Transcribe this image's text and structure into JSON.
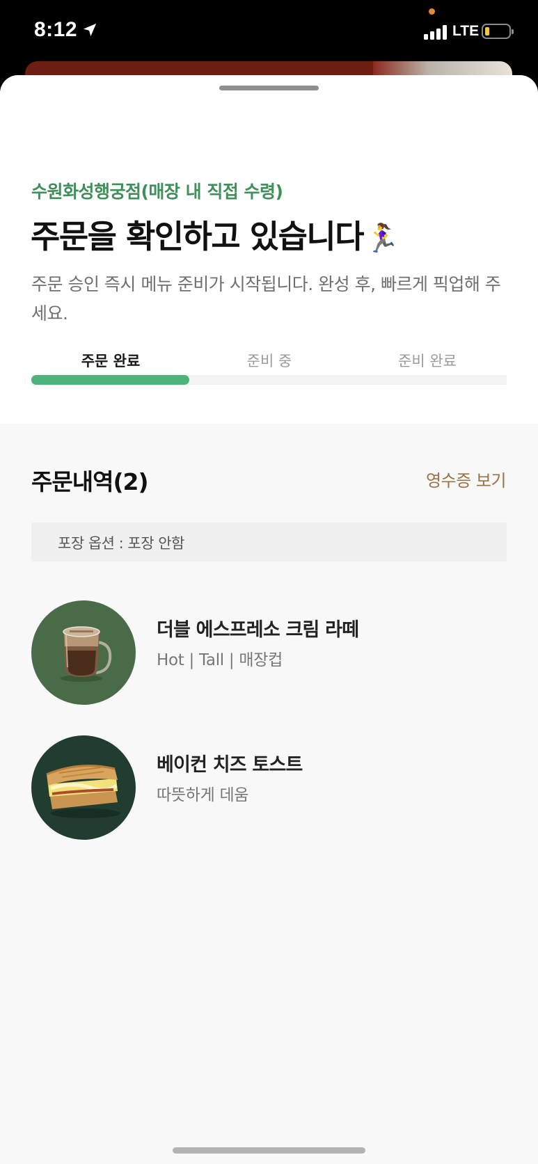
{
  "status_bar": {
    "time": "8:12",
    "network": "LTE",
    "battery_level": 0.18,
    "colors": {
      "battery_fill": "#f6c838",
      "privacy_dot": "#e08a3c"
    }
  },
  "order_status": {
    "store_name": "수원화성행궁점(매장 내 직접 수령)",
    "headline": "주문을 확인하고 있습니다",
    "headline_emoji": "🏃‍♀️",
    "description": "주문 승인 즉시 메뉴 준비가 시작됩니다. 완성 후, 빠르게 픽업해 주세요.",
    "steps": [
      {
        "label": "주문 완료",
        "active": true
      },
      {
        "label": "준비 중",
        "active": false
      },
      {
        "label": "준비 완료",
        "active": false
      }
    ],
    "progress_fraction": 0.333,
    "colors": {
      "store": "#3f8f5a",
      "progress": "#4cb37a"
    }
  },
  "order_details": {
    "title": "주문내역(2)",
    "receipt_link": "영수증 보기",
    "packaging_option": "포장 옵션 : 포장 안함",
    "items": [
      {
        "name": "더블 에스프레소 크림 라떼",
        "options": "Hot | Tall | 매장컵",
        "image": "latte-mug"
      },
      {
        "name": "베이컨 치즈 토스트",
        "options": "따뜻하게 데움",
        "image": "bacon-cheese-toast"
      }
    ],
    "colors": {
      "receipt_link": "#9a7246"
    }
  }
}
